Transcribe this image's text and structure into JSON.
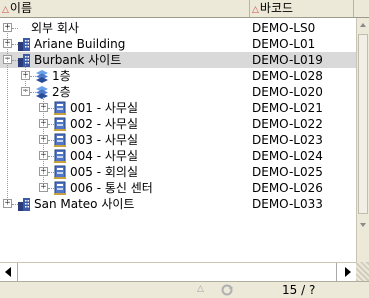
{
  "columns": {
    "name": "이름",
    "barcode": "바코드"
  },
  "rows": [
    {
      "label": "외부 회사",
      "code": "DEMO-LS0",
      "icon": "none",
      "expander": "+",
      "level": 0,
      "selected": false
    },
    {
      "label": "Ariane Building",
      "code": "DEMO-L01",
      "icon": "building-icon",
      "expander": "+",
      "level": 0,
      "selected": false
    },
    {
      "label": "Burbank 사이트",
      "code": "DEMO-L019",
      "icon": "building-icon",
      "expander": "-",
      "level": 0,
      "selected": true
    },
    {
      "label": "1층",
      "code": "DEMO-L028",
      "icon": "floor-icon",
      "expander": "+",
      "level": 1,
      "selected": false
    },
    {
      "label": "2층",
      "code": "DEMO-L020",
      "icon": "floor-icon",
      "expander": "-",
      "level": 1,
      "selected": false
    },
    {
      "label": "001 - 사무실",
      "code": "DEMO-L021",
      "icon": "room-icon",
      "expander": "+",
      "level": 2,
      "selected": false
    },
    {
      "label": "002 - 사무실",
      "code": "DEMO-L022",
      "icon": "room-icon",
      "expander": "+",
      "level": 2,
      "selected": false
    },
    {
      "label": "003 - 사무실",
      "code": "DEMO-L023",
      "icon": "room-icon",
      "expander": "+",
      "level": 2,
      "selected": false
    },
    {
      "label": "004 - 사무실",
      "code": "DEMO-L024",
      "icon": "room-icon",
      "expander": "+",
      "level": 2,
      "selected": false
    },
    {
      "label": "005 - 회의실",
      "code": "DEMO-L025",
      "icon": "room-icon",
      "expander": "+",
      "level": 2,
      "selected": false
    },
    {
      "label": "006 - 통신 센터",
      "code": "DEMO-L026",
      "icon": "room-icon",
      "expander": "+",
      "level": 2,
      "selected": false
    },
    {
      "label": "San Mateo 사이트",
      "code": "DEMO-L033",
      "icon": "building-icon",
      "expander": "+",
      "level": 0,
      "selected": false
    }
  ],
  "status": {
    "count": "15 / ?"
  },
  "colors": {
    "selected_row": "#d9d9d9",
    "header_bg": "#ece9d8",
    "sort_arrow": "#d04a4a"
  }
}
